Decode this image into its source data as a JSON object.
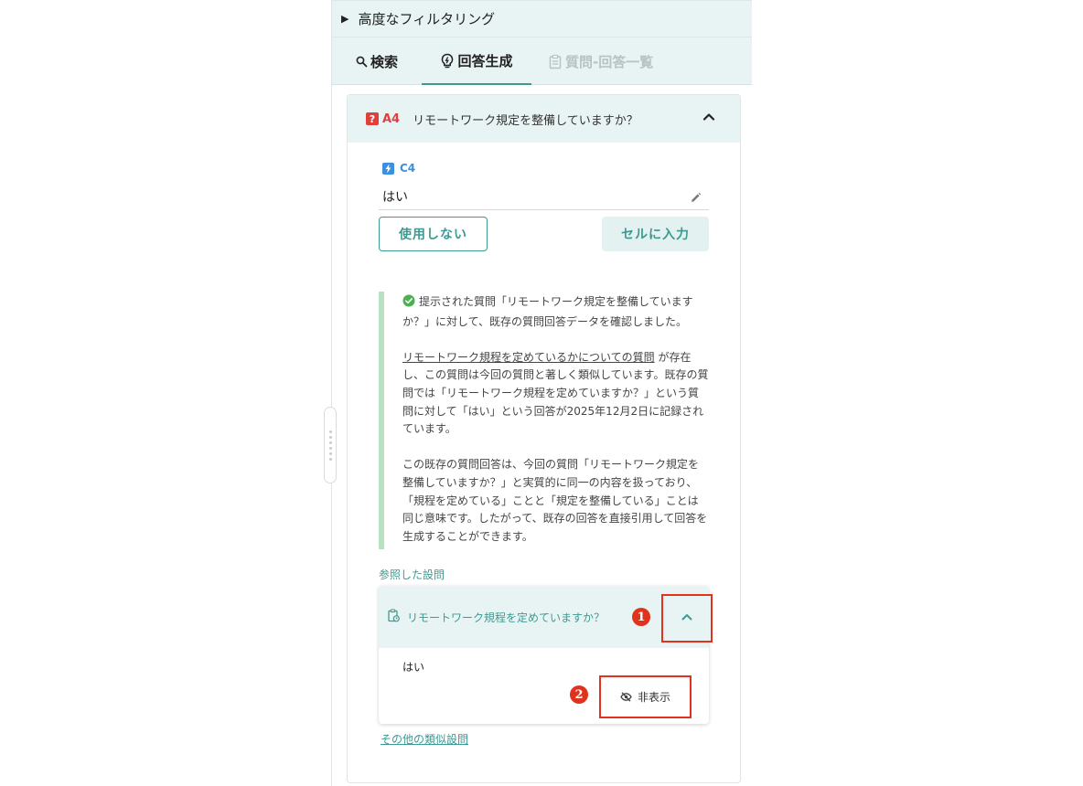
{
  "filter": {
    "label": "高度なフィルタリング"
  },
  "tabs": [
    {
      "label": "検索"
    },
    {
      "label": "回答生成"
    },
    {
      "label": "質問-回答一覧"
    }
  ],
  "question": {
    "code": "A4",
    "text": "リモートワーク規定を整備していますか？"
  },
  "cell": {
    "code": "C4"
  },
  "answer": {
    "value": "はい"
  },
  "buttons": {
    "unused": "使用しない",
    "enter_cell": "セルに入力"
  },
  "explanation": {
    "p1": "提示された質問「リモートワーク規定を整備していますか？」に対して、既存の質問回答データを確認しました。",
    "p2_link": "リモートワーク規程を定めているかについての質問",
    "p2_rest": " が存在し、この質問は今回の質問と著しく類似しています。既存の質問では「リモートワーク規程を定めていますか？」という質問に対して「はい」という回答が2025年12月2日に記録されています。",
    "p3": "この既存の質問回答は、今回の質問「リモートワーク規定を整備していますか？」と実質的に同一の内容を扱っており、「規程を定めている」ことと「規定を整備している」ことは同じ意味です。したがって、既存の回答を直接引用して回答を生成することができます。"
  },
  "reference": {
    "section_label": "参照した設問",
    "question": "リモートワーク規程を定めていますか？",
    "answer": "はい",
    "hide_label": "非表示",
    "badge1": "1",
    "badge2": "2"
  },
  "more": {
    "label": "その他の類似設問"
  },
  "colors": {
    "accent": "#3d9a92",
    "question_red": "#e0403c",
    "cell_blue": "#3b8fe0",
    "highlight_red": "#e1321e"
  }
}
